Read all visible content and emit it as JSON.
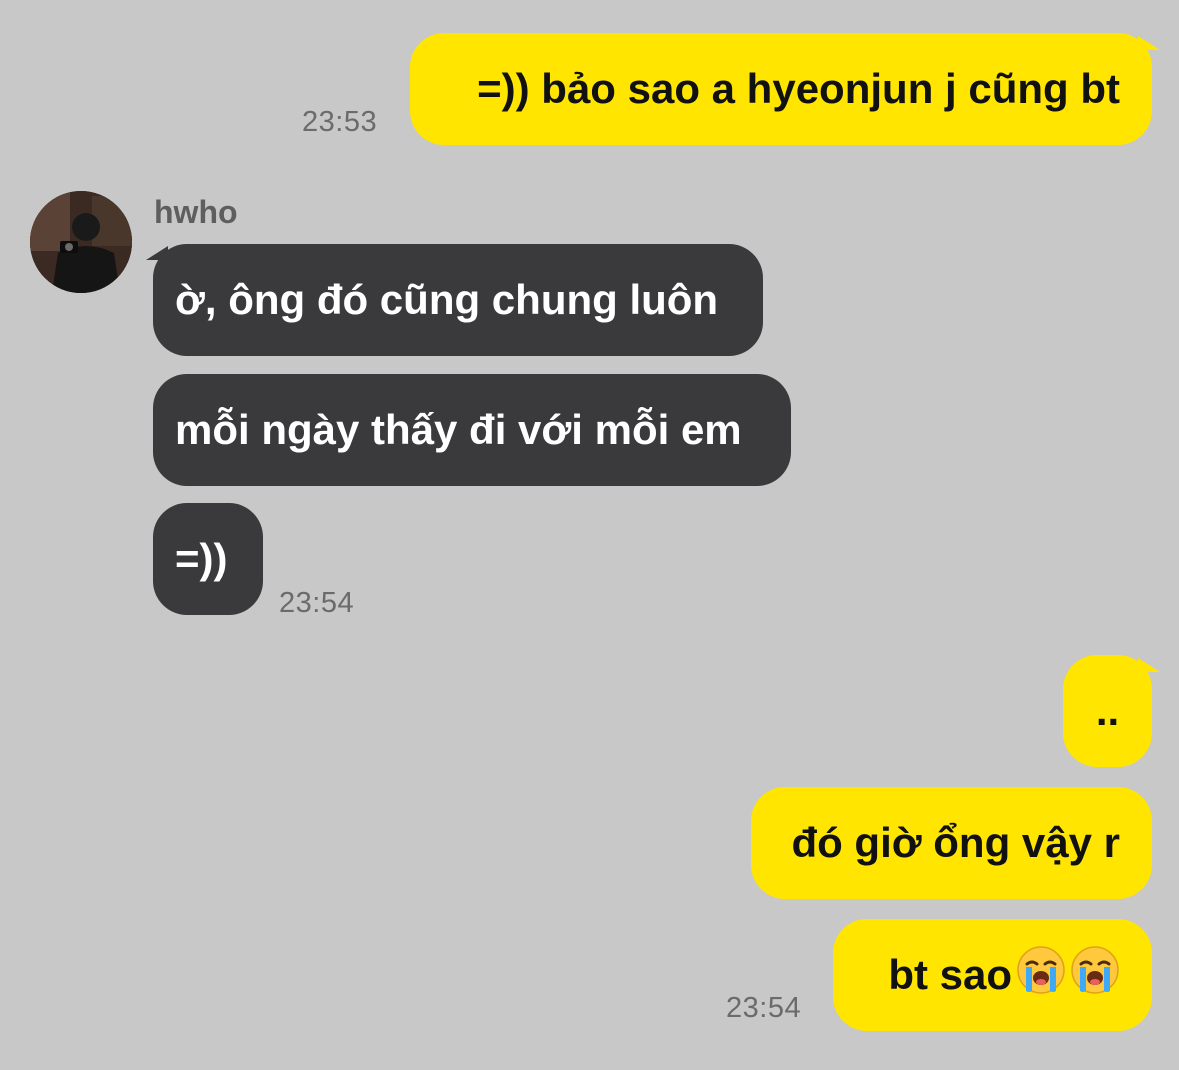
{
  "colors": {
    "background": "#c8c8c8",
    "outgoing_bubble": "#ffe500",
    "incoming_bubble": "#3a3a3d",
    "timestamp": "#6b6b6b"
  },
  "contact": {
    "name": "hwho",
    "avatar_icon": "profile-photo-icon"
  },
  "messages": [
    {
      "direction": "outgoing",
      "text": "=)) bảo sao a hyeonjun j cũng bt",
      "time": "23:53"
    },
    {
      "direction": "incoming",
      "text": "ờ, ông đó cũng chung luôn"
    },
    {
      "direction": "incoming",
      "text": "mỗi ngày thấy đi với mỗi em"
    },
    {
      "direction": "incoming",
      "text": "=))",
      "time": "23:54"
    },
    {
      "direction": "outgoing",
      "text": ".."
    },
    {
      "direction": "outgoing",
      "text": "đó giờ ổng vậy r"
    },
    {
      "direction": "outgoing",
      "text": "bt sao",
      "emoji": [
        "loudly-crying-face-icon",
        "loudly-crying-face-icon"
      ],
      "time": "23:54"
    }
  ]
}
